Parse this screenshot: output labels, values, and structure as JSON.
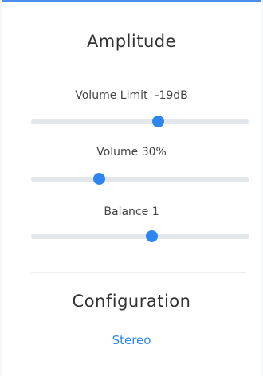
{
  "amplitude": {
    "title": "Amplitude",
    "volume_limit": {
      "label": "Volume Limit",
      "value": "-19dB",
      "position": 0.58
    },
    "volume": {
      "label": "Volume",
      "value": "30%",
      "position": 0.31
    },
    "balance": {
      "label": "Balance",
      "value": "1",
      "position": 0.55
    }
  },
  "configuration": {
    "title": "Configuration",
    "mode": "Stereo"
  },
  "colors": {
    "accent": "#2d86f0",
    "track": "#e3e6ea",
    "top_border": "#4a8ef0"
  }
}
